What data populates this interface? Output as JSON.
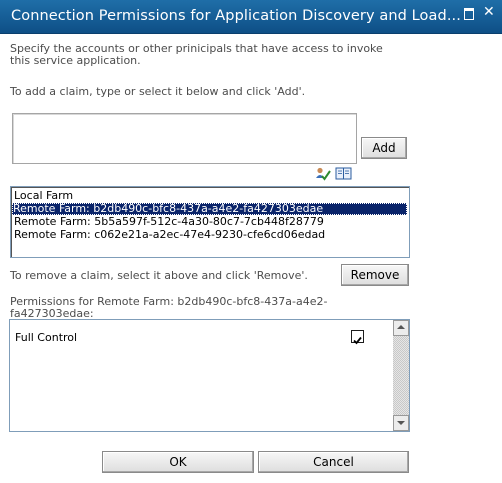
{
  "dialog": {
    "title": "Connection Permissions for Application Discovery and Load...",
    "maximize_icon": "maximize-icon",
    "close_icon": "close-icon"
  },
  "instructions": {
    "line1": "Specify the accounts or other prinicipals that have access to invoke",
    "line2": "this service application.",
    "add_hint": "To add a claim, type or select it below and click 'Add'."
  },
  "claim_input": {
    "value": ""
  },
  "add_button": {
    "label": "Add"
  },
  "picker_icons": [
    "check-names-icon",
    "address-book-icon"
  ],
  "claims": [
    {
      "label": "Local Farm",
      "selected": false
    },
    {
      "label": "Remote Farm: b2db490c-bfc8-437a-a4e2-fa427303edae",
      "selected": true
    },
    {
      "label": "Remote Farm: 5b5a597f-512c-4a30-80c7-7cb448f28779",
      "selected": false
    },
    {
      "label": "Remote Farm: c062e21a-a2ec-47e4-9230-cfe6cd06edad",
      "selected": false
    }
  ],
  "remove_hint": "To remove a claim, select it above and click 'Remove'.",
  "remove_button": {
    "label": "Remove"
  },
  "permissions": {
    "heading_line1": "Permissions for Remote Farm: b2db490c-bfc8-437a-a4e2-",
    "heading_line2": "fa427303edae:",
    "items": [
      {
        "label": "Full Control",
        "checked": true
      }
    ]
  },
  "footer": {
    "ok_label": "OK",
    "cancel_label": "Cancel"
  },
  "colors": {
    "titlebar": "#1a63a0",
    "selection": "#0a246a",
    "text": "#4c4c4c"
  }
}
